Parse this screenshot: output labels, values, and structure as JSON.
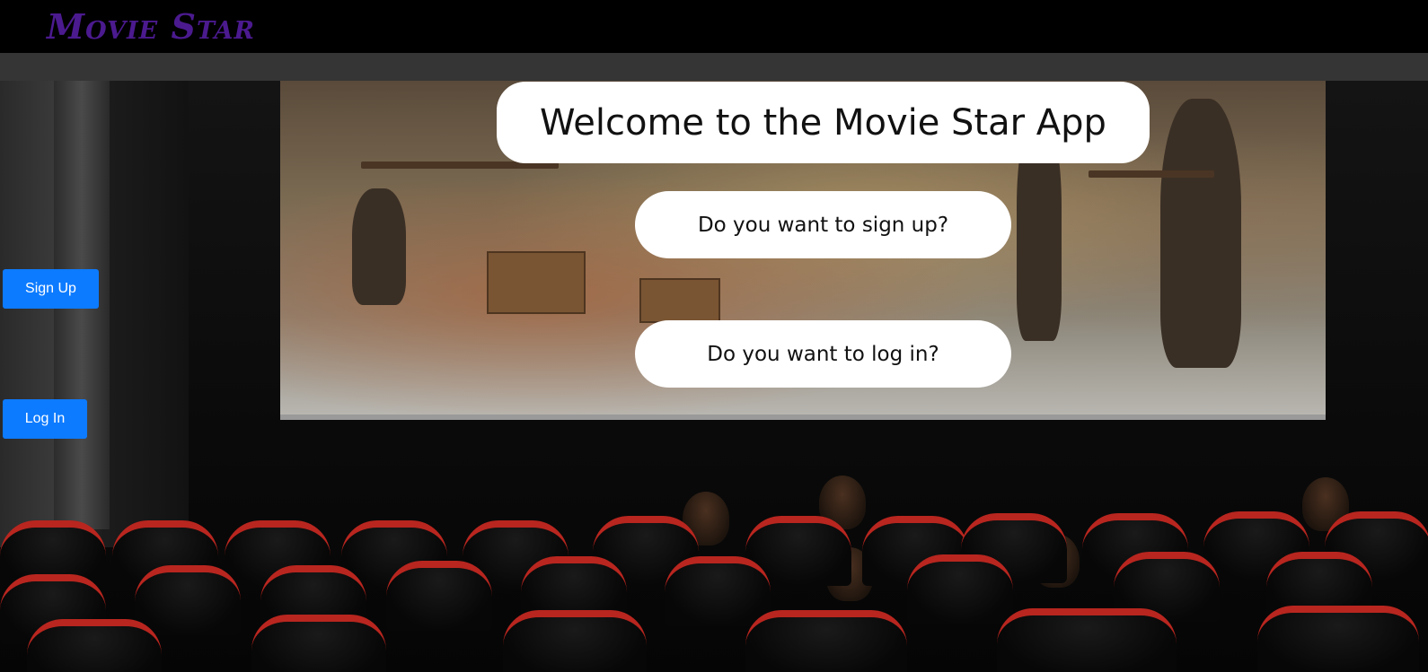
{
  "header": {
    "brand": "Movie Star",
    "brand_color": "#4b1a8f"
  },
  "hero": {
    "title": "Welcome to the Movie Star App",
    "signup_question": "Do you want to sign up?",
    "login_question": "Do you want to log in?"
  },
  "actions": {
    "signup_label": "Sign Up",
    "login_label": "Log In",
    "button_color": "#0d7bff"
  },
  "background": {
    "subject": "cinema-hall-photo"
  }
}
